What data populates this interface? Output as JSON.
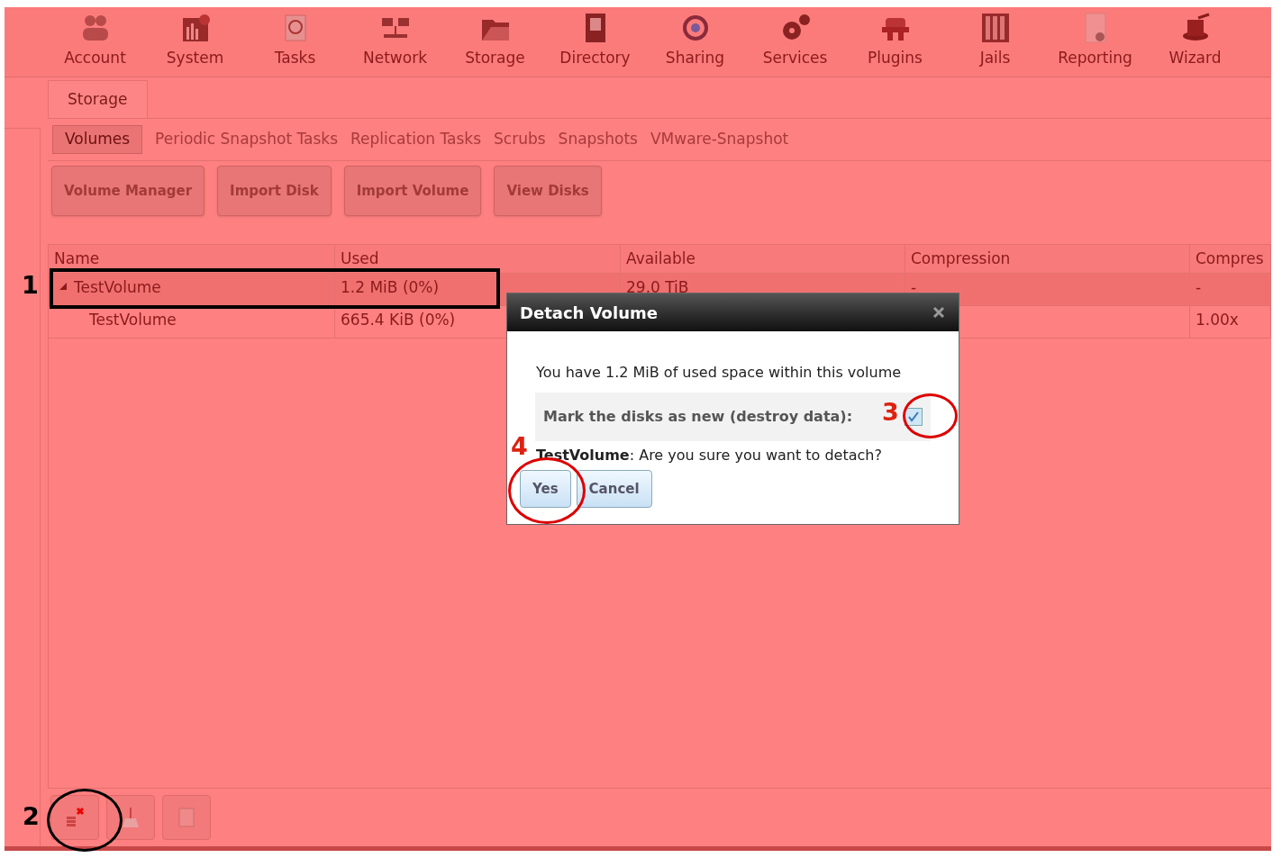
{
  "nav": [
    {
      "label": "Account"
    },
    {
      "label": "System"
    },
    {
      "label": "Tasks"
    },
    {
      "label": "Network"
    },
    {
      "label": "Storage"
    },
    {
      "label": "Directory"
    },
    {
      "label": "Sharing"
    },
    {
      "label": "Services"
    },
    {
      "label": "Plugins"
    },
    {
      "label": "Jails"
    },
    {
      "label": "Reporting"
    },
    {
      "label": "Wizard"
    }
  ],
  "tabs": [
    {
      "label": "Storage",
      "selected": true
    }
  ],
  "subtabs": [
    {
      "label": "Volumes",
      "selected": true
    },
    {
      "label": "Periodic Snapshot Tasks",
      "selected": false
    },
    {
      "label": "Replication Tasks",
      "selected": false
    },
    {
      "label": "Scrubs",
      "selected": false
    },
    {
      "label": "Snapshots",
      "selected": false
    },
    {
      "label": "VMware-Snapshot",
      "selected": false
    }
  ],
  "actions": [
    "Volume Manager",
    "Import Disk",
    "Import Volume",
    "View Disks"
  ],
  "table": {
    "columns": [
      "Name",
      "Used",
      "Available",
      "Compression",
      "Compres"
    ],
    "rows": [
      {
        "cells": [
          "TestVolume",
          "1.2 MiB (0%)",
          "29.0 TiB",
          "-",
          "-"
        ],
        "selected": true,
        "expanded": true,
        "children": [
          {
            "cells": [
              "TestVolume",
              "665.4 KiB (0%)",
              null,
              null,
              "1.00x"
            ],
            "selected": false
          }
        ]
      }
    ]
  },
  "dialog": {
    "title": "Detach Volume",
    "message": "You have 1.2 MiB of used space within this volume",
    "checkbox": {
      "label": "Mark the disks as new (destroy data):",
      "checked": true
    },
    "confirm": "**TestVolume**: Are you sure you want to detach?",
    "buttons": [
      "Yes",
      "Cancel"
    ]
  },
  "annotations": [
    {
      "label": "1"
    },
    {
      "label": "2"
    },
    {
      "label": "3"
    },
    {
      "label": "4"
    }
  ]
}
